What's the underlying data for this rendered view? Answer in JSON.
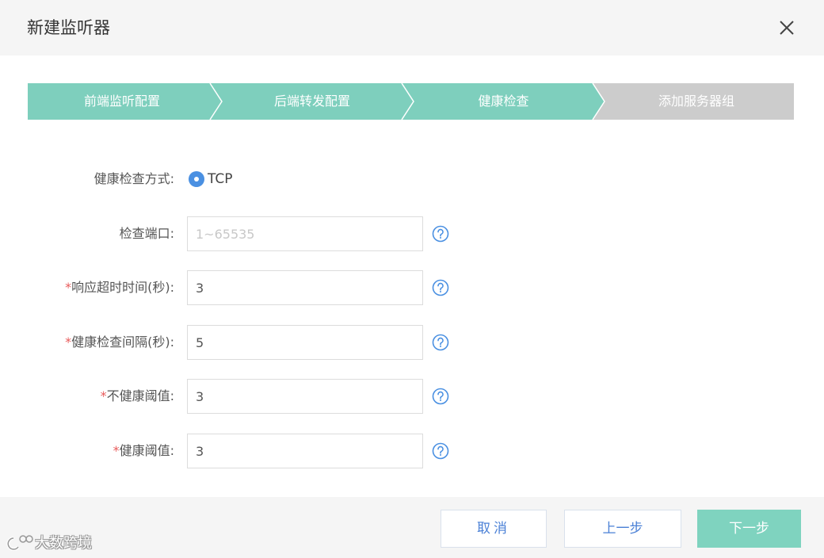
{
  "dialog": {
    "title": "新建监听器",
    "close_icon": "close-icon"
  },
  "steps": [
    {
      "label": "前端监听配置",
      "state": "done"
    },
    {
      "label": "后端转发配置",
      "state": "done"
    },
    {
      "label": "健康检查",
      "state": "active"
    },
    {
      "label": "添加服务器组",
      "state": "pending"
    }
  ],
  "colors": {
    "step_done": "#7ecfbd",
    "step_pending": "#cccccc",
    "accent_blue": "#4a90e2",
    "required": "#e85b5b",
    "next_button": "#7fd3bf"
  },
  "form": {
    "check_method": {
      "label": "健康检查方式:",
      "option": "TCP",
      "selected": true
    },
    "check_port": {
      "label": "检查端口:",
      "value": "",
      "placeholder": "1~65535",
      "help_icon": "question-circle-icon"
    },
    "response_timeout": {
      "required_mark": "*",
      "label": "响应超时时间(秒):",
      "value": "3",
      "help_icon": "question-circle-icon"
    },
    "check_interval": {
      "required_mark": "*",
      "label": "健康检查间隔(秒):",
      "value": "5",
      "help_icon": "question-circle-icon"
    },
    "unhealthy_threshold": {
      "required_mark": "*",
      "label": "不健康阈值:",
      "value": "3",
      "help_icon": "question-circle-icon"
    },
    "healthy_threshold": {
      "required_mark": "*",
      "label": "健康阈值:",
      "value": "3",
      "help_icon": "question-circle-icon"
    }
  },
  "footer": {
    "cancel_label": "取消",
    "prev_label": "上一步",
    "next_label": "下一步"
  },
  "watermark": {
    "text": "大数跨境"
  }
}
